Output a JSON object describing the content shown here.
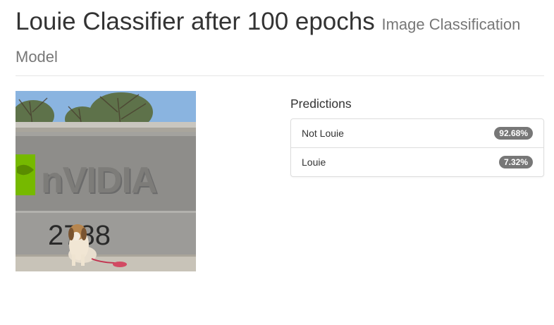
{
  "header": {
    "title": "Louie Classifier after 100 epochs",
    "subtitle": "Image Classification Model"
  },
  "image": {
    "sign_text": "nVIDIA",
    "address_number": "2788"
  },
  "predictions": {
    "heading": "Predictions",
    "items": [
      {
        "label": "Not Louie",
        "value": "92.68%"
      },
      {
        "label": "Louie",
        "value": "7.32%"
      }
    ]
  },
  "colors": {
    "badge": "#777777",
    "nvidia_green": "#76b900",
    "sky": "#8ab4e0"
  }
}
